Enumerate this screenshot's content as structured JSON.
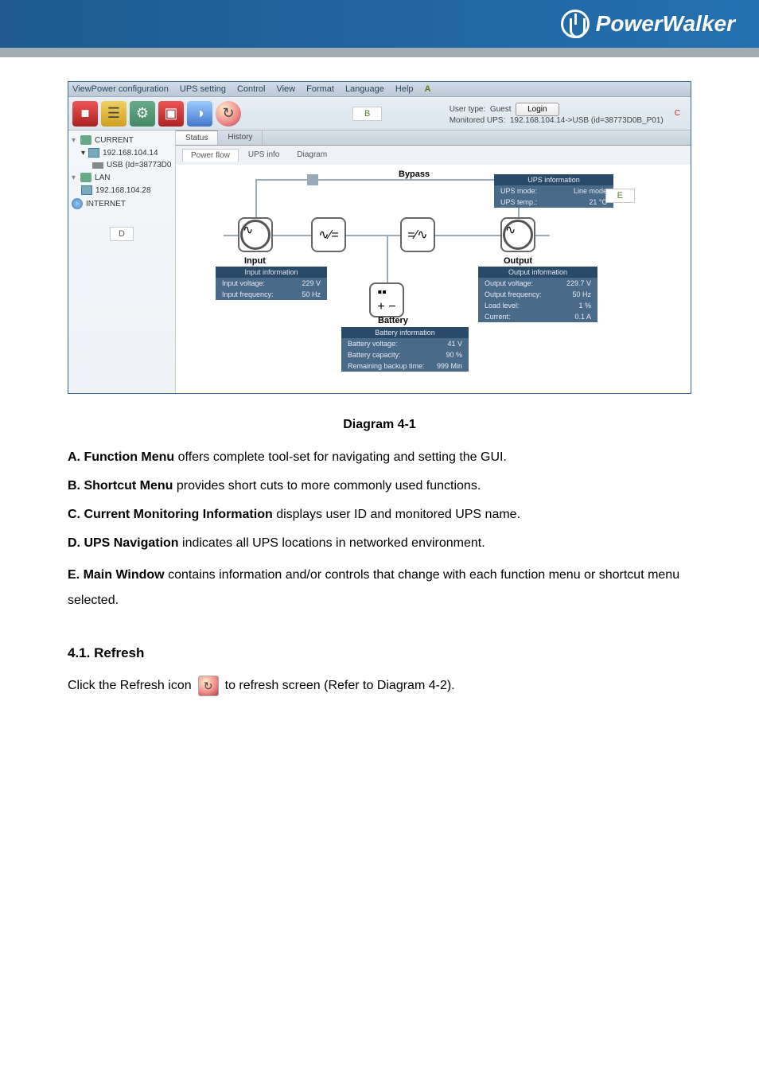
{
  "brand": "PowerWalker",
  "menu": {
    "items": [
      "ViewPower configuration",
      "UPS setting",
      "Control",
      "View",
      "Format",
      "Language",
      "Help"
    ],
    "marker": "A"
  },
  "toolbar": {
    "marker_b": "B",
    "user_type_label": "User type:",
    "user_type_value": "Guest",
    "login_label": "Login",
    "monitored_label": "Monitored UPS:",
    "monitored_value": "192.168.104.14->USB (id=38773D0B_P01)",
    "marker_c": "C"
  },
  "sidebar": {
    "current": "CURRENT",
    "ip1": "192.168.104.14",
    "usb": "USB (Id=38773D0",
    "lan": "LAN",
    "ip2": "192.168.104.28",
    "internet": "INTERNET",
    "marker_d": "D"
  },
  "main_tabs": {
    "status": "Status",
    "history": "History"
  },
  "sub_tabs": {
    "power_flow": "Power flow",
    "ups_info": "UPS info",
    "diagram": "Diagram"
  },
  "diagram": {
    "bypass": "Bypass",
    "input": "Input",
    "output": "Output",
    "battery": "Battery",
    "ups_info": {
      "header": "UPS information",
      "mode_label": "UPS mode:",
      "mode_value": "Line mode",
      "temp_label": "UPS temp.:",
      "temp_value": "21 °C"
    },
    "input_info": {
      "header": "Input information",
      "volt_label": "Input voltage:",
      "volt_value": "229 V",
      "freq_label": "Input frequency:",
      "freq_value": "50 Hz"
    },
    "output_info": {
      "header": "Output information",
      "volt_label": "Output voltage:",
      "volt_value": "229.7 V",
      "freq_label": "Output frequency:",
      "freq_value": "50 Hz",
      "load_label": "Load level:",
      "load_value": "1 %",
      "curr_label": "Current:",
      "curr_value": "0.1 A"
    },
    "battery_info": {
      "header": "Battery information",
      "volt_label": "Battery voltage:",
      "volt_value": "41 V",
      "cap_label": "Battery capacity:",
      "cap_value": "90 %",
      "time_label": "Remaining backup time:",
      "time_value": "999 Min"
    },
    "marker_e": "E"
  },
  "caption": "Diagram 4-1",
  "descriptions": {
    "a_bold": "A. Function Menu",
    "a_text": " offers complete tool-set for navigating and setting the GUI.",
    "b_bold": "B. Shortcut Menu",
    "b_text": " provides short cuts to more commonly used functions.",
    "c_bold": "C. Current Monitoring Information",
    "c_text": " displays user ID and monitored UPS name.",
    "d_bold": "D. UPS Navigation",
    "d_text": " indicates all UPS locations in networked environment.",
    "e_bold": "E. Main Window",
    "e_text": " contains information and/or controls that change with each function menu or shortcut menu selected."
  },
  "section": "4.1. Refresh",
  "refresh": {
    "pre": "Click the Refresh icon",
    "post": "to refresh screen (Refer to Diagram 4-2)."
  }
}
